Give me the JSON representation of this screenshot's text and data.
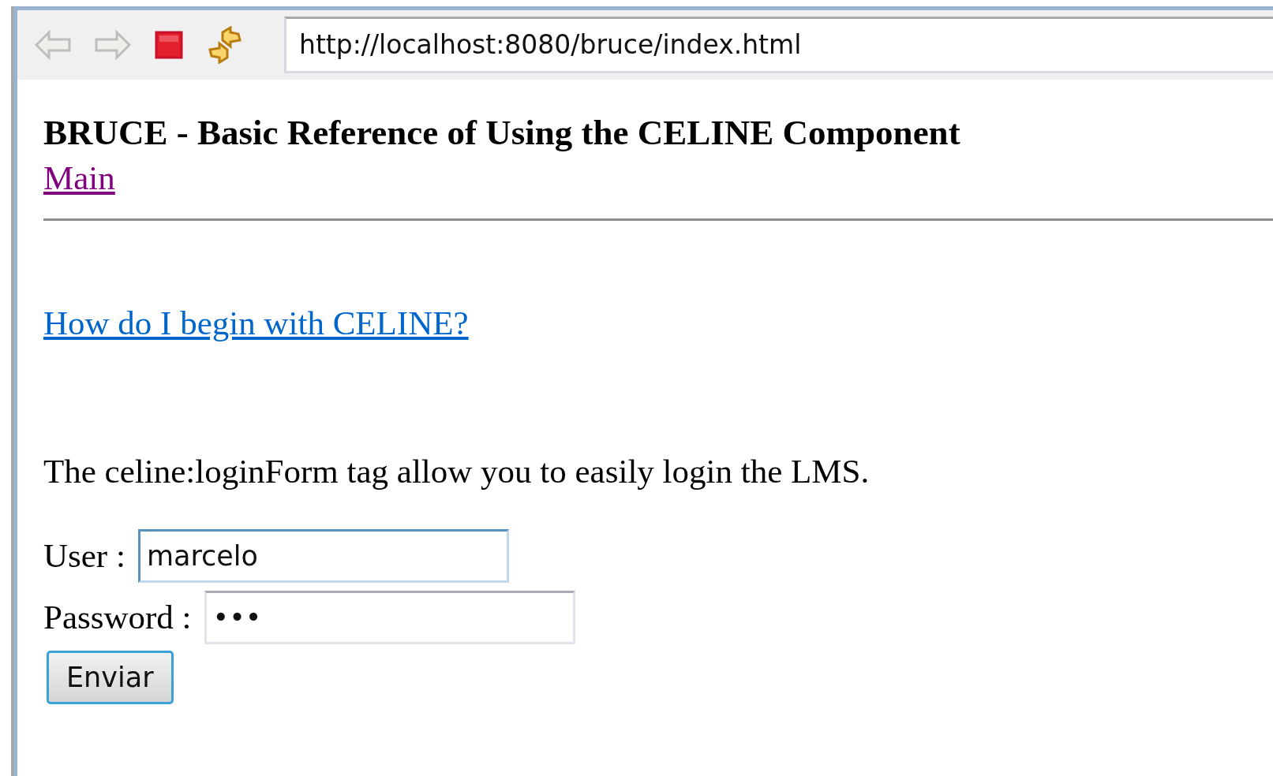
{
  "toolbar": {
    "back": {
      "disabled": true
    },
    "forward": {
      "disabled": true
    },
    "address": "http://localhost:8080/bruce/index.html"
  },
  "page": {
    "title": "BRUCE - Basic Reference of Using the CELINE Component",
    "nav_link": {
      "label": "Main",
      "visited": true
    },
    "help_link": {
      "label": "How do I begin with CELINE?",
      "visited": false
    },
    "description": "The celine:loginForm tag allow you to easily login the LMS.",
    "form": {
      "fields": [
        {
          "label": "User :",
          "value": "marcelo",
          "focused": true
        },
        {
          "label": "Password :",
          "value": "•••",
          "focused": false
        }
      ],
      "submit": "Enviar"
    }
  }
}
